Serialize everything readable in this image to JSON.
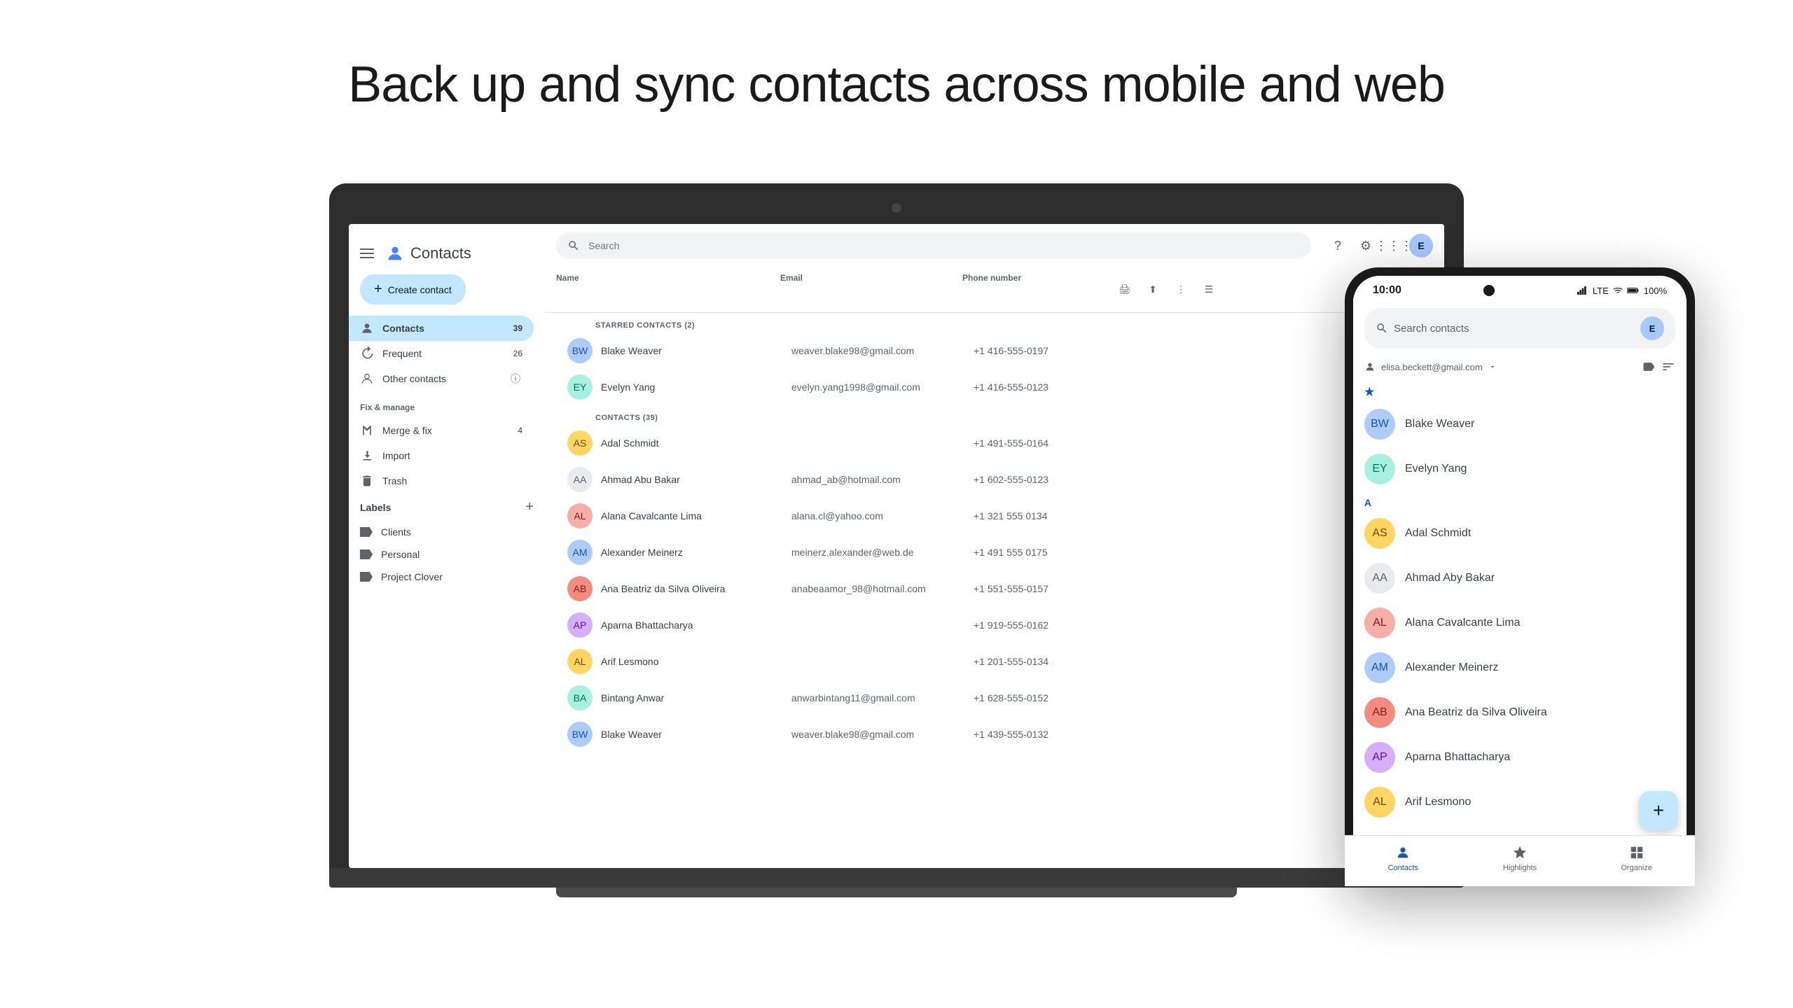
{
  "header": {
    "title": "Back up and sync contacts across mobile and web"
  },
  "desktop_app": {
    "app_name": "Contacts",
    "search_placeholder": "Search",
    "create_button": "Create contact",
    "nav": [
      {
        "label": "Contacts",
        "badge": "39",
        "icon": "person"
      },
      {
        "label": "Frequent",
        "badge": "26",
        "icon": "history"
      },
      {
        "label": "Other contacts",
        "badge": "",
        "icon": "person-outline"
      }
    ],
    "fix_manage": {
      "title": "Fix & manage",
      "items": [
        {
          "label": "Merge & fix",
          "badge": "4",
          "icon": "merge"
        },
        {
          "label": "Import",
          "badge": "",
          "icon": "import"
        },
        {
          "label": "Trash",
          "badge": "",
          "icon": "trash"
        }
      ]
    },
    "labels": {
      "title": "Labels",
      "items": [
        {
          "label": "Clients"
        },
        {
          "label": "Personal"
        },
        {
          "label": "Project Clover"
        }
      ]
    },
    "table_headers": {
      "name": "Name",
      "email": "Email",
      "phone": "Phone number"
    },
    "starred_section": "STARRED CONTACTS (2)",
    "contacts_section": "CONTACTS (39)",
    "starred_contacts": [
      {
        "name": "Blake Weaver",
        "email": "weaver.blake98@gmail.com",
        "phone": "+1 416-555-0197",
        "av_color": "av-blue",
        "initials": "BW"
      },
      {
        "name": "Evelyn Yang",
        "email": "evelyn.yang1998@gmail.com",
        "phone": "+1 416-555-0123",
        "av_color": "av-teal",
        "initials": "EY"
      }
    ],
    "contacts": [
      {
        "name": "Adal Schmidt",
        "email": "",
        "phone": "+1 491-555-0164",
        "av_color": "av-orange",
        "initials": "AS"
      },
      {
        "name": "Ahmad Abu Bakar",
        "email": "ahmad_ab@hotmail.com",
        "phone": "+1 602-555-0123",
        "av_color": "av-gray",
        "initials": "AA"
      },
      {
        "name": "Alana Cavalcante Lima",
        "email": "alana.cl@yahoo.com",
        "phone": "+1 321 555 0134",
        "av_color": "av-pink",
        "initials": "AL"
      },
      {
        "name": "Alexander Meinerz",
        "email": "meinerz.alexander@web.de",
        "phone": "+1 491 555 0175",
        "av_color": "av-blue",
        "initials": "AM"
      },
      {
        "name": "Ana Beatriz da Silva Oliveira",
        "email": "anabeaamor_98@hotmail.com",
        "phone": "+1 551-555-0157",
        "av_color": "av-red",
        "initials": "AB"
      },
      {
        "name": "Aparna Bhattacharya",
        "email": "",
        "phone": "+1 919-555-0162",
        "av_color": "av-purple",
        "initials": "AP"
      },
      {
        "name": "Arif Lesmono",
        "email": "",
        "phone": "+1 201-555-0134",
        "av_color": "av-orange",
        "initials": "AL"
      },
      {
        "name": "Bintang Anwar",
        "email": "anwarbintang11@gmail.com",
        "phone": "+1 628-555-0152",
        "av_color": "av-teal",
        "initials": "BA"
      },
      {
        "name": "Blake Weaver",
        "email": "weaver.blake98@gmail.com",
        "phone": "+1 439-555-0132",
        "av_color": "av-blue",
        "initials": "BW"
      }
    ]
  },
  "mobile_app": {
    "status_time": "10:00",
    "status_lte": "LTE",
    "status_battery": "100%",
    "search_placeholder": "Search contacts",
    "account": "elisa.beckett@gmail.com",
    "contacts": [
      {
        "name": "Blake Weaver",
        "starred": true,
        "av_color": "av-blue",
        "initials": "BW"
      },
      {
        "name": "Evelyn Yang",
        "starred": true,
        "av_color": "av-teal",
        "initials": "EY"
      },
      {
        "name": "Adal Schmidt",
        "section": "A",
        "av_color": "av-orange",
        "initials": "AS"
      },
      {
        "name": "Ahmad Aby Bakar",
        "av_color": "av-gray",
        "initials": "AA"
      },
      {
        "name": "Alana Cavalcante Lima",
        "av_color": "av-pink",
        "initials": "AL"
      },
      {
        "name": "Alexander Meinerz",
        "av_color": "av-blue",
        "initials": "AM"
      },
      {
        "name": "Ana Beatriz da Silva Oliveira",
        "av_color": "av-red",
        "initials": "AB"
      },
      {
        "name": "Aparna Bhattacharya",
        "av_color": "av-purple",
        "initials": "AP"
      },
      {
        "name": "Arif Lesmono",
        "av_color": "av-orange",
        "initials": "AL"
      }
    ],
    "bottom_nav": [
      {
        "label": "Contacts",
        "icon": "person",
        "active": true
      },
      {
        "label": "Highlights",
        "icon": "star",
        "active": false
      },
      {
        "label": "Organize",
        "icon": "grid",
        "active": false
      }
    ]
  }
}
